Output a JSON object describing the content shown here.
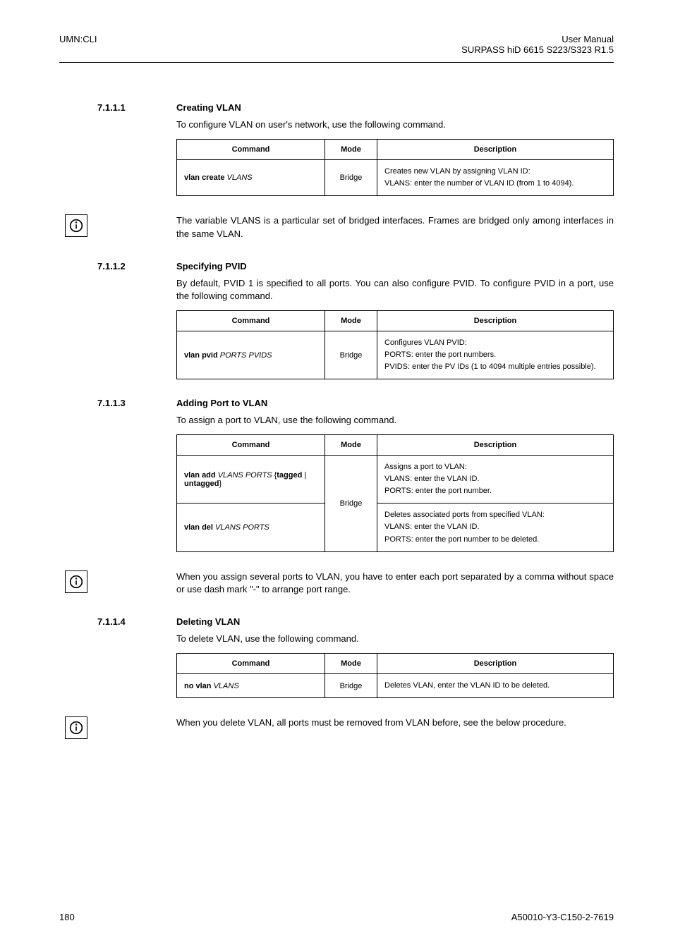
{
  "header": {
    "left": "UMN:CLI",
    "right_line1": "User Manual",
    "right_line2": "SURPASS hiD 6615 S223/S323 R1.5"
  },
  "footer": {
    "left": "180",
    "right": "A50010-Y3-C150-2-7619"
  },
  "sections": {
    "s1": {
      "num": "7.1.1.1",
      "title": "Creating VLAN",
      "intro": "To configure VLAN on user's network, use the following command.",
      "table": {
        "h1": "Command",
        "h2": "Mode",
        "h3": "Description",
        "r1c1_a": "vlan create",
        "r1c1_b": "VLANS",
        "r1c2": "Bridge",
        "r1c3_a": "Creates new VLAN by assigning VLAN ID:",
        "r1c3_b": "VLANS: enter the number of VLAN ID (from 1 to 4094)."
      },
      "note": "The variable VLANS is a particular set of bridged interfaces. Frames are bridged only among interfaces in the same VLAN."
    },
    "s2": {
      "num": "7.1.1.2",
      "title": "Specifying PVID",
      "intro": "By default, PVID 1 is specified to all ports. You can also configure PVID. To configure PVID in a port, use the following command.",
      "table": {
        "h1": "Command",
        "h2": "Mode",
        "h3": "Description",
        "r1c1_a": "vlan pvid",
        "r1c1_b": "PORTS PVIDS",
        "r1c2": "Bridge",
        "r1c3_a": "Configures VLAN PVID:",
        "r1c3_b": "PORTS: enter the port numbers.",
        "r1c3_c": "PVIDS: enter the PV IDs (1 to 4094 multiple entries possible)."
      }
    },
    "s3": {
      "num": "7.1.1.3",
      "title": "Adding Port to VLAN",
      "intro": "To assign a port to VLAN, use the following command.",
      "table": {
        "h1": "Command",
        "h2": "Mode",
        "h3": "Description",
        "r1c1_pre": "vlan add",
        "r1c1_vlans": "VLANS PORTS",
        "r1c1_brace_open": "{",
        "r1c1_opts": "tagged",
        "r1c1_pipe": " | ",
        "r1c1_opts2": "untagged",
        "r1c1_brace_close": "}",
        "r1c3_a": "Assigns a port to VLAN:",
        "r1c3_b": "VLANS: enter the VLAN ID.",
        "r1c3_c": "PORTS: enter the port number.",
        "r2c1_a": "vlan del",
        "r2c1_b": "VLANS PORTS",
        "r2c2": "Bridge",
        "r2c3_a": "Deletes associated ports from specified VLAN:",
        "r2c3_b": "VLANS: enter the VLAN ID.",
        "r2c3_c": "PORTS: enter the port number to be deleted."
      },
      "note": "When you assign several ports to VLAN, you have to enter each port separated by a comma without space or use dash mark \"-\" to arrange port range."
    },
    "s4": {
      "num": "7.1.1.4",
      "title": "Deleting VLAN",
      "intro": "To delete VLAN, use the following command.",
      "table": {
        "h1": "Command",
        "h2": "Mode",
        "h3": "Description",
        "r1c1_a": "no vlan",
        "r1c1_b": "VLANS",
        "r1c2": "Bridge",
        "r1c3": "Deletes VLAN, enter the VLAN ID to be deleted."
      },
      "note": "When you delete VLAN, all ports must be removed from VLAN before, see the below procedure."
    }
  }
}
